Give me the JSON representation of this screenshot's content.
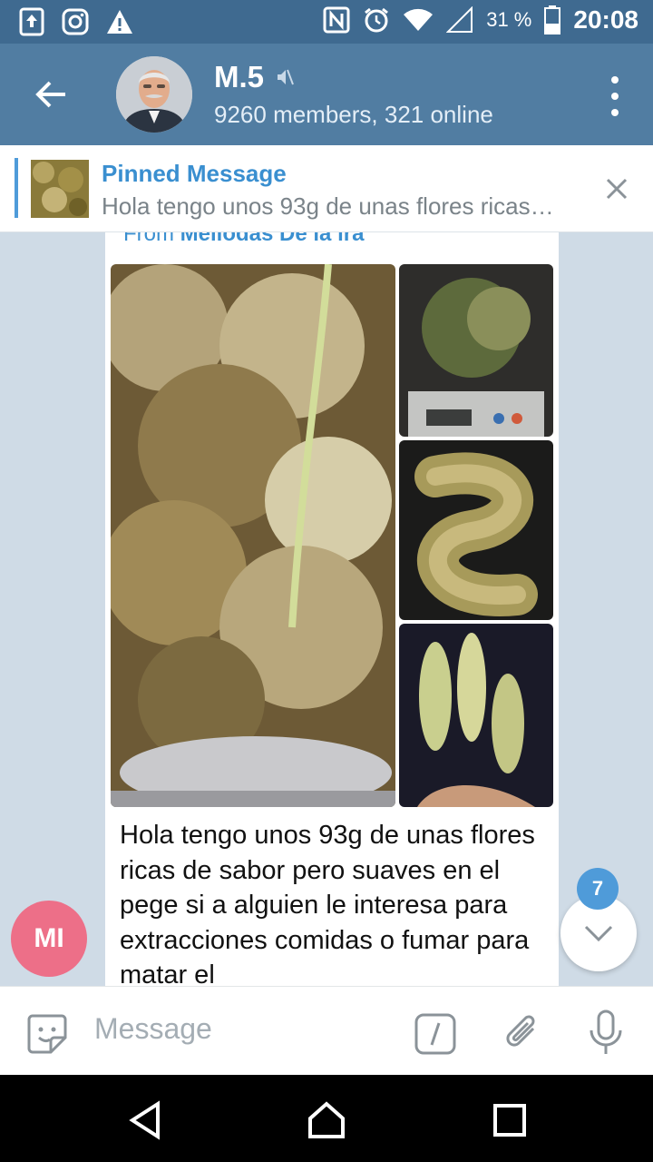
{
  "status_bar": {
    "battery_percent": "31 %",
    "time": "20:08",
    "icons": [
      "upload-icon",
      "instagram-icon",
      "warning-icon",
      "nfc-icon",
      "alarm-icon",
      "wifi-icon",
      "signal-icon",
      "battery-icon"
    ]
  },
  "header": {
    "title": "M.5",
    "subtitle": "9260 members, 321 online",
    "muted": true
  },
  "pinned": {
    "title": "Pinned Message",
    "text": "Hola tengo unos 93g de unas flores ricas…"
  },
  "message": {
    "from_prefix": "From",
    "from_name": "Meliodas De la ira",
    "text": "Hola tengo unos 93g de unas flores ricas de sabor pero suaves en el pege si a alguien le interesa para extracciones comidas o fumar para matar el",
    "sender_initials": "MI",
    "photo_count": 4
  },
  "scroll_down": {
    "unread_count": "7"
  },
  "composer": {
    "placeholder": "Message"
  },
  "colors": {
    "header": "#517da2",
    "status_bar": "#3f6a90",
    "accent": "#3a8fd0",
    "avatar_mi": "#ed6f88",
    "chat_background": "#cfdbe6"
  }
}
